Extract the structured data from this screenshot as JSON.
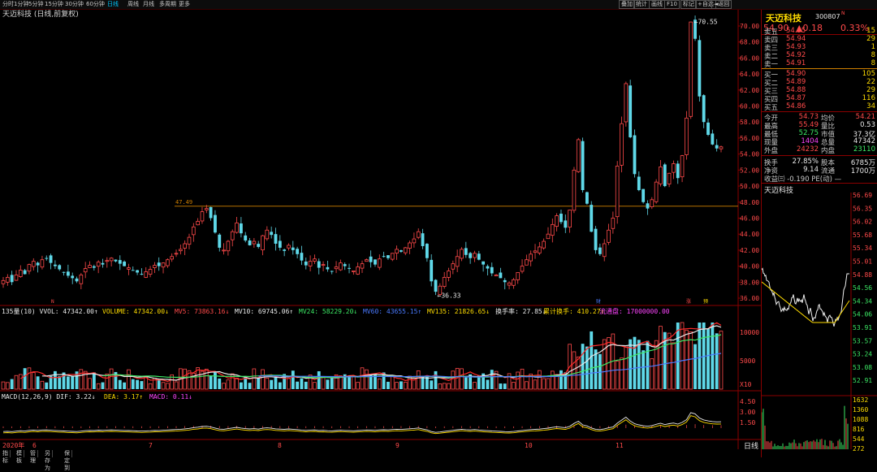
{
  "toolbar": {
    "periods": [
      "分时",
      "1分钟",
      "5分钟",
      "15分钟",
      "30分钟",
      "60分钟",
      "日线",
      "周线",
      "月线",
      "多周期",
      "更多"
    ],
    "active_period": "日线",
    "tools": [
      "叠加",
      "统计",
      "画线",
      "F10",
      "标记",
      "+自选",
      "◄返回"
    ]
  },
  "title": {
    "name": "天迈科技",
    "mode": "(日线,前复权)"
  },
  "main_chart": {
    "price_labels": [
      "70.00",
      "68.00",
      "66.00",
      "64.00",
      "62.00",
      "60.00",
      "58.00",
      "56.00",
      "54.00",
      "52.00",
      "50.00",
      "48.00",
      "46.00",
      "44.00",
      "42.00",
      "40.00",
      "38.00",
      "36.00"
    ],
    "high_marker": "70.55",
    "low_marker": "36.33",
    "ref_line_label": "47.49",
    "markers": {
      "m1": "N",
      "m2": "财",
      "m3": "涨",
      "m4": "预"
    }
  },
  "volume_panel": {
    "items": [
      {
        "text": "135量(10) VVOL: 47342.00↑",
        "color": "#e8e8e8"
      },
      {
        "text": "VOLUME: 47342.00↓",
        "color": "#ffdc00"
      },
      {
        "text": "MV5: 73863.16↓",
        "color": "#ff4a4a"
      },
      {
        "text": "MV10: 69745.06↑",
        "color": "#e8e8e8"
      },
      {
        "text": "MV24: 58229.20↓",
        "color": "#3ce864"
      },
      {
        "text": "MV60: 43655.15↑",
        "color": "#4a7aff"
      },
      {
        "text": "MV135: 21826.65↓",
        "color": "#ffdc00"
      },
      {
        "text": "换手率: 27.85↓",
        "color": "#e8e8e8"
      },
      {
        "text": "累计换手: 410.27↑",
        "color": "#ffdc00"
      },
      {
        "text": "流通盘: 17000000.00",
        "color": "#ff44ff"
      }
    ],
    "axis": [
      "10000",
      "5000",
      "X10"
    ]
  },
  "macd_panel": {
    "items": [
      {
        "text": "MACD(12,26,9) DIF: 3.22↓",
        "color": "#e8e8e8"
      },
      {
        "text": "DEA: 3.17↑",
        "color": "#ffdc00"
      },
      {
        "text": "MACD: 0.11↓",
        "color": "#ff44ff"
      }
    ],
    "axis": [
      "4.50",
      "3.00",
      "1.50"
    ]
  },
  "date_axis": {
    "labels": [
      "2020年",
      "6",
      "7",
      "8",
      "9",
      "10",
      "11"
    ]
  },
  "bottom_tabs": [
    "指标",
    "模板",
    "管理",
    "另存为",
    "保定到"
  ],
  "sidebar": {
    "name": "天迈科技",
    "code": "300807",
    "code_suffix": "N",
    "price": "54.90",
    "change": "▲0.18",
    "change_pct": "0.33%",
    "asks": [
      {
        "label": "卖五",
        "price": "54.95",
        "vol": "15"
      },
      {
        "label": "卖四",
        "price": "54.94",
        "vol": "29"
      },
      {
        "label": "卖三",
        "price": "54.93",
        "vol": "1"
      },
      {
        "label": "卖二",
        "price": "54.92",
        "vol": "8"
      },
      {
        "label": "卖一",
        "price": "54.91",
        "vol": "8"
      }
    ],
    "bids": [
      {
        "label": "买一",
        "price": "54.90",
        "vol": "105"
      },
      {
        "label": "买二",
        "price": "54.89",
        "vol": "22"
      },
      {
        "label": "买三",
        "price": "54.88",
        "vol": "29"
      },
      {
        "label": "买四",
        "price": "54.87",
        "vol": "116"
      },
      {
        "label": "买五",
        "price": "54.86",
        "vol": "34"
      }
    ],
    "stats": [
      {
        "l1": "今开",
        "v1": "54.73",
        "c1": "#ff4a4a",
        "l2": "均价",
        "v2": "54.21",
        "c2": "#ff4a4a"
      },
      {
        "l1": "最高",
        "v1": "55.49",
        "c1": "#ff4a4a",
        "l2": "量比",
        "v2": "0.53",
        "c2": "#e8e8e8"
      },
      {
        "l1": "最低",
        "v1": "52.75",
        "c1": "#3ce864",
        "l2": "市值",
        "v2": "37.3亿",
        "c2": "#e8e8e8"
      },
      {
        "l1": "现量",
        "v1": "1404",
        "c1": "#ff44ff",
        "l2": "总量",
        "v2": "47342",
        "c2": "#e8e8e8"
      },
      {
        "l1": "外盘",
        "v1": "24232",
        "c1": "#ff4a4a",
        "l2": "内盘",
        "v2": "23110",
        "c2": "#3ce864"
      }
    ],
    "stats2": [
      {
        "l1": "换手",
        "v1": "27.85%",
        "l2": "股本",
        "v2": "6785万"
      },
      {
        "l1": "净资",
        "v1": "9.14",
        "l2": "流通",
        "v2": "1700万"
      }
    ],
    "pe_row": "收益㈢ -0.190 PE(动)   —",
    "mini_title": "天迈科技",
    "mini_price_labels": [
      "56.69",
      "56.35",
      "56.02",
      "55.68",
      "55.34",
      "55.01",
      "54.88",
      "54.56",
      "54.34",
      "54.06",
      "53.91",
      "53.57",
      "53.24",
      "53.08",
      "52.91"
    ],
    "mini_vol_labels": [
      "1632",
      "1360",
      "1088",
      "816",
      "544",
      "272"
    ],
    "bottom_tab": "日线"
  }
}
